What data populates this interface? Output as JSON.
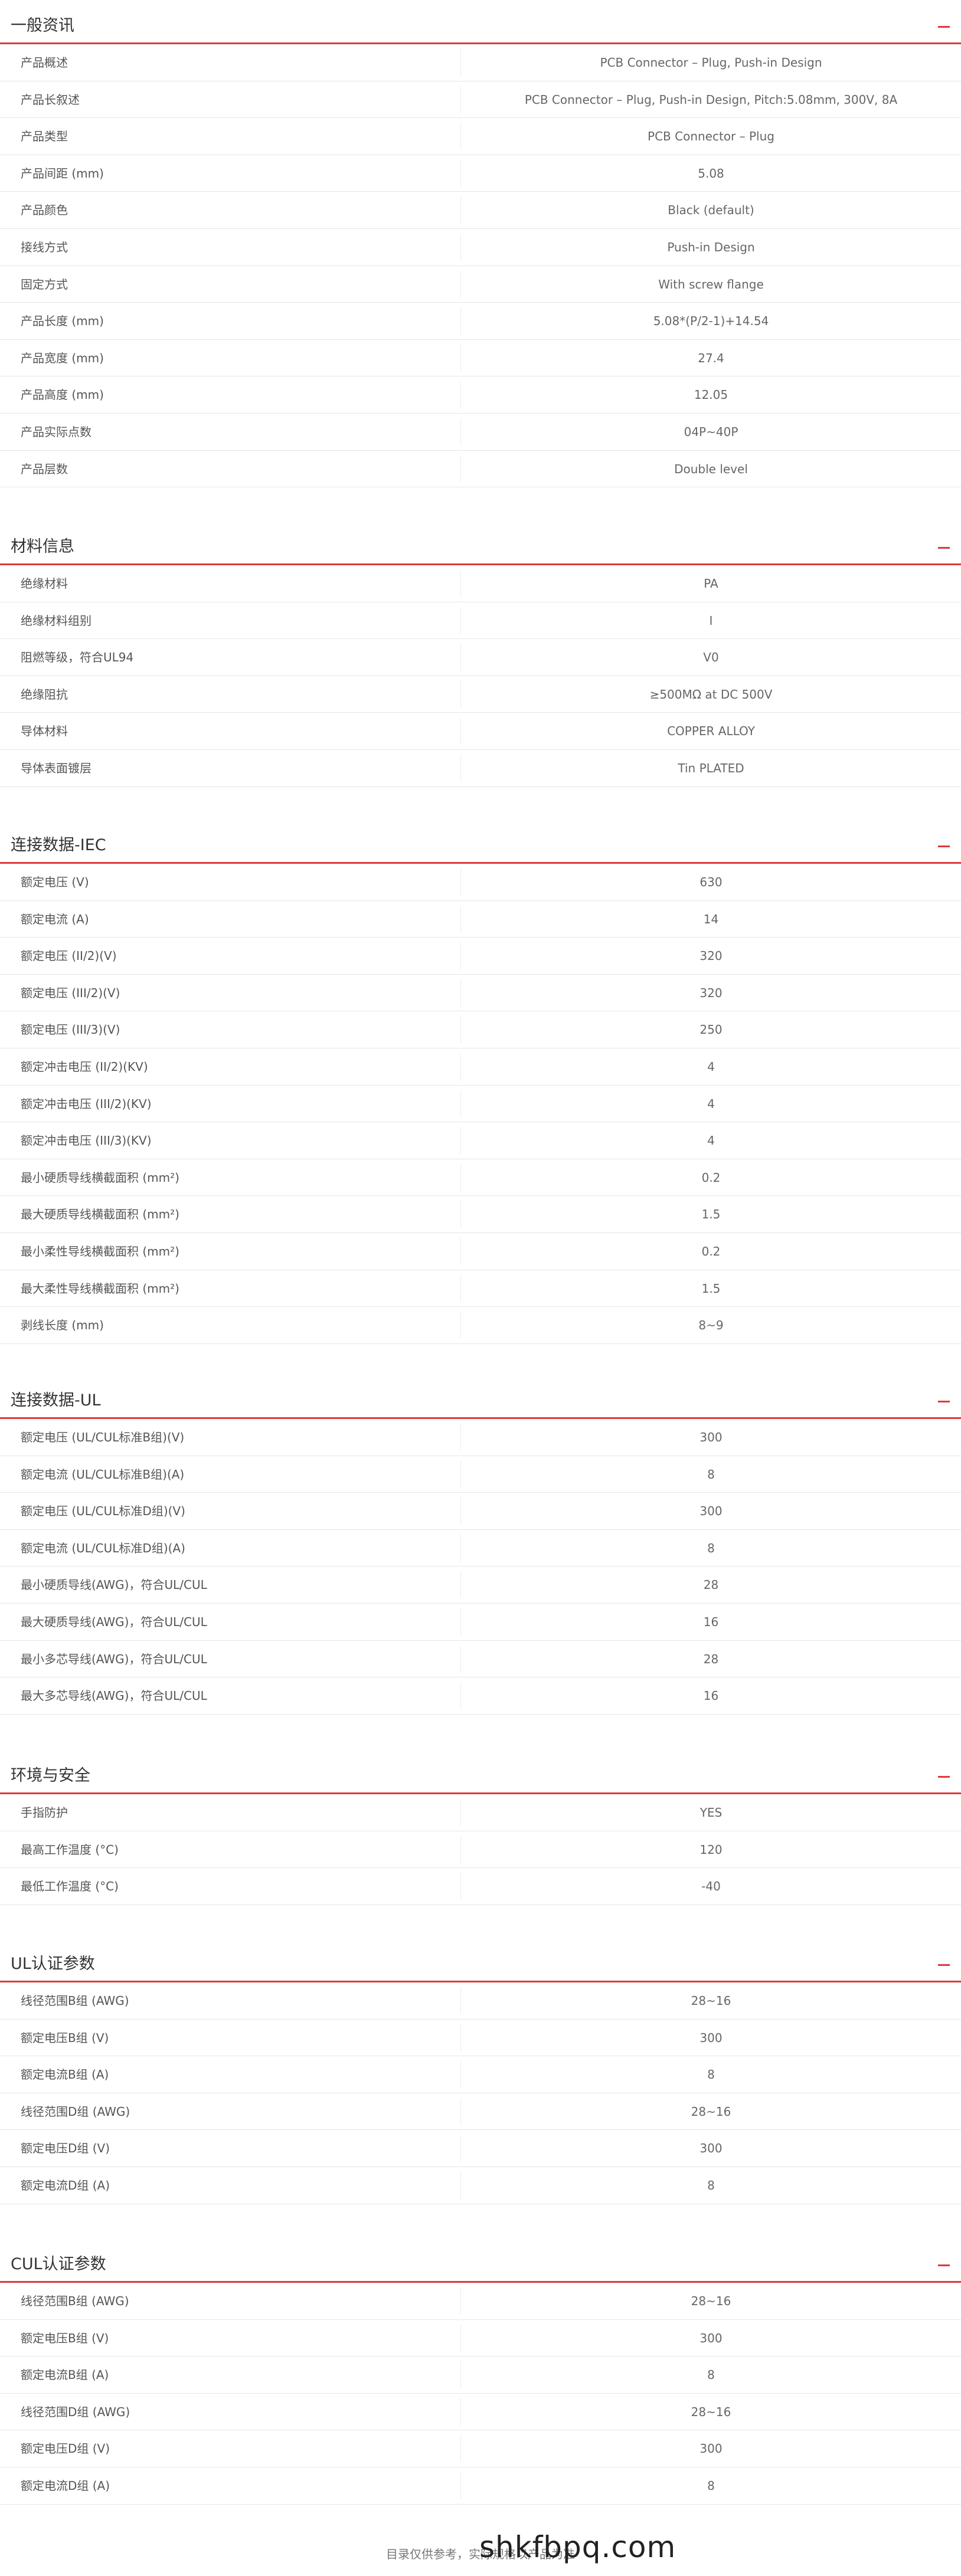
{
  "sections": [
    {
      "title": "一般资讯",
      "rows": [
        {
          "label": "产品概述",
          "value": "PCB Connector – Plug, Push-in Design"
        },
        {
          "label": "产品长叙述",
          "value": "PCB Connector – Plug, Push-in Design, Pitch:5.08mm, 300V, 8A"
        },
        {
          "label": "产品类型",
          "value": "PCB Connector – Plug"
        },
        {
          "label": "产品间距 (mm)",
          "value": "5.08"
        },
        {
          "label": "产品颜色",
          "value": "Black (default)"
        },
        {
          "label": "接线方式",
          "value": "Push-in Design"
        },
        {
          "label": "固定方式",
          "value": "With screw flange"
        },
        {
          "label": "产品长度 (mm)",
          "value": "5.08*(P/2-1)+14.54"
        },
        {
          "label": "产品宽度 (mm)",
          "value": "27.4"
        },
        {
          "label": "产品高度 (mm)",
          "value": "12.05"
        },
        {
          "label": "产品实际点数",
          "value": "04P~40P"
        },
        {
          "label": "产品层数",
          "value": "Double level"
        }
      ]
    },
    {
      "title": "材料信息",
      "rows": [
        {
          "label": "绝缘材料",
          "value": "PA"
        },
        {
          "label": "绝缘材料组别",
          "value": "I"
        },
        {
          "label": "阻燃等级，符合UL94",
          "value": "V0"
        },
        {
          "label": "绝缘阻抗",
          "value": "≥500MΩ at DC 500V"
        },
        {
          "label": "导体材料",
          "value": "COPPER ALLOY"
        },
        {
          "label": "导体表面镀层",
          "value": "Tin PLATED"
        }
      ]
    },
    {
      "title": "连接数据-IEC",
      "rows": [
        {
          "label": "额定电压 (V)",
          "value": "630"
        },
        {
          "label": "额定电流 (A)",
          "value": "14"
        },
        {
          "label": "额定电压 (II/2)(V)",
          "value": "320"
        },
        {
          "label": "额定电压 (III/2)(V)",
          "value": "320"
        },
        {
          "label": "额定电压 (III/3)(V)",
          "value": "250"
        },
        {
          "label": "额定冲击电压 (II/2)(KV)",
          "value": "4"
        },
        {
          "label": "额定冲击电压 (III/2)(KV)",
          "value": "4"
        },
        {
          "label": "额定冲击电压 (III/3)(KV)",
          "value": "4"
        },
        {
          "label": "最小硬质导线横截面积 (mm²)",
          "value": "0.2"
        },
        {
          "label": "最大硬质导线横截面积 (mm²)",
          "value": "1.5"
        },
        {
          "label": "最小柔性导线横截面积 (mm²)",
          "value": "0.2"
        },
        {
          "label": "最大柔性导线横截面积 (mm²)",
          "value": "1.5"
        },
        {
          "label": "剥线长度 (mm)",
          "value": "8~9"
        }
      ]
    },
    {
      "title": "连接数据-UL",
      "rows": [
        {
          "label": "额定电压 (UL/CUL标准B组)(V)",
          "value": "300"
        },
        {
          "label": "额定电流 (UL/CUL标准B组)(A)",
          "value": "8"
        },
        {
          "label": "额定电压 (UL/CUL标准D组)(V)",
          "value": "300"
        },
        {
          "label": "额定电流 (UL/CUL标准D组)(A)",
          "value": "8"
        },
        {
          "label": "最小硬质导线(AWG)，符合UL/CUL",
          "value": "28"
        },
        {
          "label": "最大硬质导线(AWG)，符合UL/CUL",
          "value": "16"
        },
        {
          "label": "最小多芯导线(AWG)，符合UL/CUL",
          "value": "28"
        },
        {
          "label": "最大多芯导线(AWG)，符合UL/CUL",
          "value": "16"
        }
      ]
    },
    {
      "title": "环境与安全",
      "rows": [
        {
          "label": "手指防护",
          "value": "YES"
        },
        {
          "label": "最高工作温度 (°C)",
          "value": "120"
        },
        {
          "label": "最低工作温度 (°C)",
          "value": "-40"
        }
      ]
    },
    {
      "title": "UL认证参数",
      "rows": [
        {
          "label": "线径范围B组 (AWG)",
          "value": "28~16"
        },
        {
          "label": "额定电压B组 (V)",
          "value": "300"
        },
        {
          "label": "额定电流B组 (A)",
          "value": "8"
        },
        {
          "label": "线径范围D组 (AWG)",
          "value": "28~16"
        },
        {
          "label": "额定电压D组 (V)",
          "value": "300"
        },
        {
          "label": "额定电流D组 (A)",
          "value": "8"
        }
      ]
    },
    {
      "title": "CUL认证参数",
      "rows": [
        {
          "label": "线径范围B组 (AWG)",
          "value": "28~16"
        },
        {
          "label": "额定电压B组 (V)",
          "value": "300"
        },
        {
          "label": "额定电流B组 (A)",
          "value": "8"
        },
        {
          "label": "线径范围D组 (AWG)",
          "value": "28~16"
        },
        {
          "label": "额定电压D组 (V)",
          "value": "300"
        },
        {
          "label": "额定电流D组 (A)",
          "value": "8"
        }
      ]
    }
  ],
  "footer": {
    "note": "目录仅供参考，实际规格以产品为准",
    "watermark": "shkfbpq.com"
  },
  "colors": {
    "accent": "#e0383a",
    "row_border": "#e6e6e6",
    "text": "#666666",
    "title": "#333333"
  }
}
